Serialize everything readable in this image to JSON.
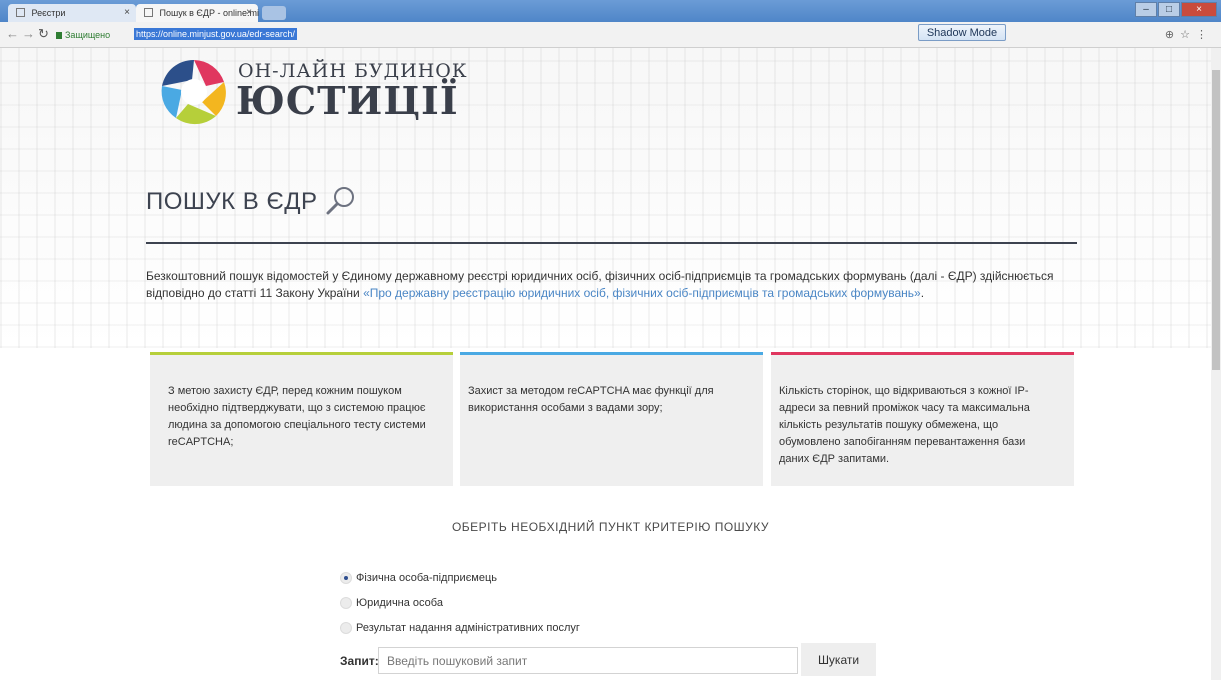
{
  "browser": {
    "tabs": [
      {
        "label": "Реєстри"
      },
      {
        "label": "Пошук в ЄДР - online.mi"
      }
    ],
    "close_glyph": "×",
    "secure_label": "Защищено",
    "url": "https://online.minjust.gov.ua/edr-search/",
    "shadow_mode_label": "Shadow Mode",
    "window_controls": [
      "–",
      "□",
      "×"
    ]
  },
  "logo": {
    "line1": "ОН-ЛАЙН БУДИНОК",
    "line2": "ЮСТИЦІЇ",
    "colors": [
      "#e0375f",
      "#4aa9e3",
      "#2c4f8a",
      "#b6cf3a",
      "#f3b61f"
    ]
  },
  "page": {
    "title": "ПОШУК В ЄДР",
    "intro_text": "Безкоштовний пошук відомостей у Єдиному державному реєстрі юридичних осіб, фізичних осіб-підприємців та громадських формувань (далі - ЄДР) здійснюється відповідно до статті 11 Закону України ",
    "intro_link": "«Про державну реєстрацію юридичних осіб, фізичних осіб-підприємців та громадських формувань»",
    "intro_tail": "."
  },
  "cards": [
    {
      "text": "З метою захисту ЄДР, перед кожним пошуком необхідно підтверджувати, що з системою працює людина за допомогою спеціального тесту системи reCAPTCHA;",
      "accent": "#b6cf3a"
    },
    {
      "text": "Захист за методом reCAPTCHA має функції для використання особами з вадами зору;",
      "accent": "#4aa9e3"
    },
    {
      "text": "Кількість сторінок, що відкриваються з кожної IP-адреси за певний проміжок часу та максимальна кількість результатів пошуку обмежена, що обумовлено запобіганням перевантаження бази даних ЄДР запитами.",
      "accent": "#e0375f"
    }
  ],
  "search": {
    "criteria_title": "ОБЕРІТЬ НЕОБХІДНИЙ ПУНКТ КРИТЕРІЮ ПОШУКУ",
    "options": [
      {
        "label": "Фізична особа-підприємець",
        "selected": true
      },
      {
        "label": "Юридична особа",
        "selected": false
      },
      {
        "label": "Результат надання адміністративних послуг",
        "selected": false
      }
    ],
    "query_label": "Запит:",
    "query_placeholder": "Введіть пошуковий запит",
    "query_value": "",
    "button_label": "Шукати"
  }
}
